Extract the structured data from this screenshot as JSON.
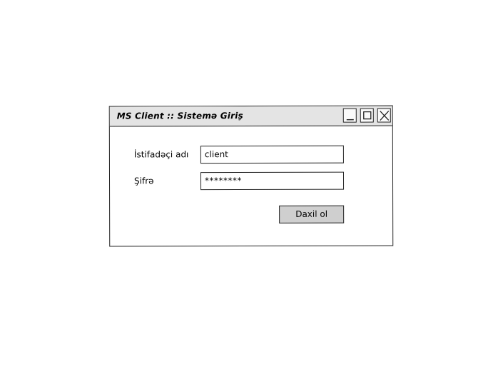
{
  "window": {
    "title": "MS Client :: Sistemə Giriş",
    "controls": [
      "minimize-icon",
      "maximize-icon",
      "close-icon"
    ]
  },
  "form": {
    "username_label": "İstifadəçi adı",
    "username_value": "client",
    "password_label": "Şifrə",
    "password_value": "********",
    "submit_label": "Daxil ol"
  },
  "colors": {
    "titlebar": "#e4e4e4",
    "button": "#cfcfcf",
    "border": "#222222"
  }
}
